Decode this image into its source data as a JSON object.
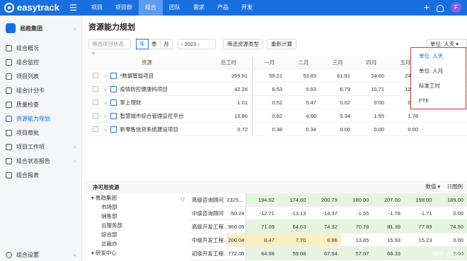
{
  "brand": "easytrack",
  "nav": [
    "项目",
    "项目群",
    "组合",
    "团队",
    "需求",
    "产品",
    "开发"
  ],
  "nav_active": 2,
  "user_initial": "F",
  "org_name": "易趋集团",
  "sidebar": [
    {
      "label": "组合概况",
      "icon": "overview-icon"
    },
    {
      "label": "组合监控",
      "icon": "monitor-icon"
    },
    {
      "label": "项目列表",
      "icon": "list-icon"
    },
    {
      "label": "组合计分卡",
      "icon": "scorecard-icon"
    },
    {
      "label": "质量检查",
      "icon": "quality-icon"
    },
    {
      "label": "资源能力规划",
      "icon": "resource-icon",
      "active": true
    },
    {
      "label": "项目审批",
      "icon": "approve-icon"
    },
    {
      "label": "项目工作项",
      "icon": "workitem-icon",
      "arrow": true
    },
    {
      "label": "组合状态报告",
      "icon": "report-icon",
      "arrow": true
    },
    {
      "label": "组合报表",
      "icon": "chart-icon"
    }
  ],
  "sidebar_bottom": "组合设置",
  "page_title": "资源能力规划",
  "filters": {
    "status_placeholder": "筛选项目状态",
    "seg": [
      "年",
      "季",
      "月"
    ],
    "year": "2023",
    "filter_type": "筛选资源类型",
    "recalc": "重新计算",
    "unit": "单位: 人天"
  },
  "table": {
    "headers": [
      "资源",
      "总工时",
      "一月",
      "二月",
      "三月",
      "四月",
      "五月"
    ],
    "rows": [
      {
        "name": "*数据智能项目",
        "total": "259.91",
        "m": [
          "59.21",
          "53.83",
          "61.91",
          "24.60",
          "24.89"
        ]
      },
      {
        "name": "疫情防控健康码项目",
        "total": "42.26",
        "m": [
          "6.53",
          "5.93",
          "6.79",
          "10.71",
          "12.30"
        ]
      },
      {
        "name": "掌上理财",
        "total": "1.01",
        "m": [
          "0.52",
          "0.47",
          "0.02",
          "0.00",
          "0.00"
        ]
      },
      {
        "name": "智慧城市综合管理监控平台",
        "total": "15.86",
        "m": [
          "0.82",
          "4.66",
          "5.34",
          "1.55",
          "1.78"
        ]
      },
      {
        "name": "新零售信贷系统建设项目",
        "total": "0.72",
        "m": [
          "0.38",
          "0.34",
          "0.00",
          "0.00",
          "0.00"
        ]
      }
    ]
  },
  "unit_menu": [
    "单位: 人天",
    "单位: 人月",
    "标准工时",
    "FTE"
  ],
  "available": {
    "title": "净可用资源",
    "right_a": "数值",
    "right_b": "图例",
    "tree": [
      "易趋集团",
      "市场部",
      "销售部",
      "云服务部",
      "综合部",
      "总裁办",
      "研发中心"
    ],
    "rows": [
      {
        "role": "高级咨询顾问",
        "total": "2325....",
        "m": [
          "194.62",
          "174.60",
          "200.79",
          "180.00",
          "207.00",
          "198.00",
          "189.00"
        ],
        "shade": "grn"
      },
      {
        "role": "中级咨询顾问",
        "total": "-50.24",
        "m": [
          "-12.71",
          "-13.13",
          "-14.37",
          "-1.55",
          "-1.78",
          "-1.71",
          "0.00"
        ],
        "shade": ""
      },
      {
        "role": "高级开发工程...",
        "total": "960.05",
        "m": [
          "71.09",
          "64.63",
          "74.32",
          "70.78",
          "81.39",
          "77.89",
          "74.50"
        ],
        "shade": "grn"
      },
      {
        "role": "中级开发工程...",
        "total": "200.04",
        "m": [
          "8.47",
          "7.70",
          "8.86",
          "13.85",
          "15.93",
          "15.23",
          "0.00"
        ],
        "shade": "yel"
      },
      {
        "role": "初级开发工程...",
        "total": "772.00",
        "m": [
          "64.98",
          "59.08",
          "67.94",
          "57.67",
          "66.33",
          "",
          "9.00"
        ],
        "shade": "grn"
      }
    ]
  },
  "watermark": "知乎 @易趋"
}
